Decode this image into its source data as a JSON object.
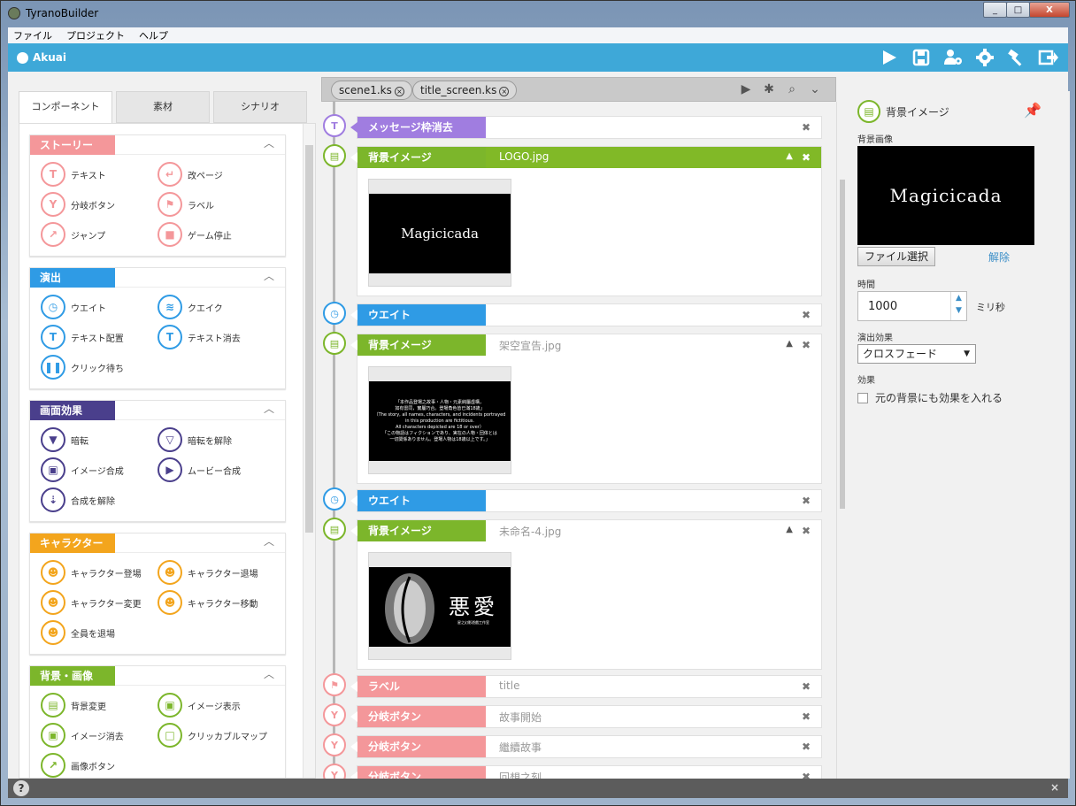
{
  "window": {
    "title": "TyranoBuilder",
    "min": "_",
    "max": "□",
    "close": "X"
  },
  "menu": [
    "ファイル",
    "プロジェクト",
    "ヘルプ"
  ],
  "topbar": {
    "project": "Akuai",
    "tools": [
      "play-icon",
      "save-icon",
      "users-gear-icon",
      "gear-icon",
      "hammer-icon",
      "export-icon"
    ]
  },
  "left": {
    "tabs": [
      "コンポーネント",
      "素材",
      "シナリオ"
    ],
    "categories": [
      {
        "label": "ストーリー",
        "color": "#f4979a",
        "items": [
          "テキスト",
          "改ページ",
          "分岐ボタン",
          "ラベル",
          "ジャンプ",
          "ゲーム停止"
        ]
      },
      {
        "label": "演出",
        "color": "#2f9be5",
        "items": [
          "ウエイト",
          "クエイク",
          "テキスト配置",
          "テキスト消去",
          "クリック待ち"
        ]
      },
      {
        "label": "画面効果",
        "color": "#4a3f8c",
        "items": [
          "暗転",
          "暗転を解除",
          "イメージ合成",
          "ムービー合成",
          "合成を解除"
        ]
      },
      {
        "label": "キャラクター",
        "color": "#f3a51d",
        "items": [
          "キャラクター登場",
          "キャラクター退場",
          "キャラクター変更",
          "キャラクター移動",
          "全員を退場"
        ]
      },
      {
        "label": "背景・画像",
        "color": "#7cb62b",
        "items": [
          "背景変更",
          "イメージ表示",
          "イメージ消去",
          "クリッカブルマップ",
          "画像ボタン"
        ]
      }
    ]
  },
  "center": {
    "files": [
      "scene1.ks",
      "title_screen.ks"
    ],
    "rows": [
      {
        "tag": "メッセージ枠消去",
        "value": "",
        "color": "#a07de0"
      },
      {
        "tag": "背景イメージ",
        "value": "LOGO.jpg",
        "color": "#7cb62b",
        "thumb": "Magicicada"
      },
      {
        "tag": "ウエイト",
        "value": "",
        "color": "#2f9be5"
      },
      {
        "tag": "背景イメージ",
        "value": "架空宣告.jpg",
        "color": "#7cb62b",
        "thumb": "disclaimer"
      },
      {
        "tag": "ウエイト",
        "value": "",
        "color": "#2f9be5"
      },
      {
        "tag": "背景イメージ",
        "value": "未命名-4.jpg",
        "color": "#7cb62b",
        "thumb": "悪愛"
      },
      {
        "tag": "ラベル",
        "value": "title",
        "color": "#f4979a"
      },
      {
        "tag": "分岐ボタン",
        "value": "故事開始",
        "color": "#f4979a"
      },
      {
        "tag": "分岐ボタン",
        "value": "繼續故事",
        "color": "#f4979a"
      },
      {
        "tag": "分岐ボタン",
        "value": "回想之刻",
        "color": "#f4979a"
      }
    ],
    "thumbs": {
      "logo": "Magicicada",
      "disclaimer": [
        "「本作品登場之故事・人物・元素純屬虛構，",
        "如有雷同，實屬巧合。登場角色皆已滿18歲」",
        "（The story, all names, characters, and incidents portrayed",
        "in this production are fictitious.",
        "All characters depicted are 18 or over）",
        "「この物語はフィクションであり、実在の人物・団体とは",
        "一切関係ありません。登場人物は18歳以上です。」"
      ],
      "akuai": "悪愛",
      "akuai_sub": "星之幻影遊戲工作室"
    }
  },
  "right": {
    "title": "背景イメージ",
    "bg_label": "背景画像",
    "preview": "Magicicada",
    "file_button": "ファイル選択",
    "clear_link": "解除",
    "time_label": "時間",
    "time_value": "1000",
    "time_unit": "ミリ秒",
    "effect_label": "演出効果",
    "effect_value": "クロスフェード",
    "effect2_label": "効果",
    "checkbox_label": "元の背景にも効果を入れる"
  },
  "status": {
    "help": "?",
    "close": "×"
  }
}
